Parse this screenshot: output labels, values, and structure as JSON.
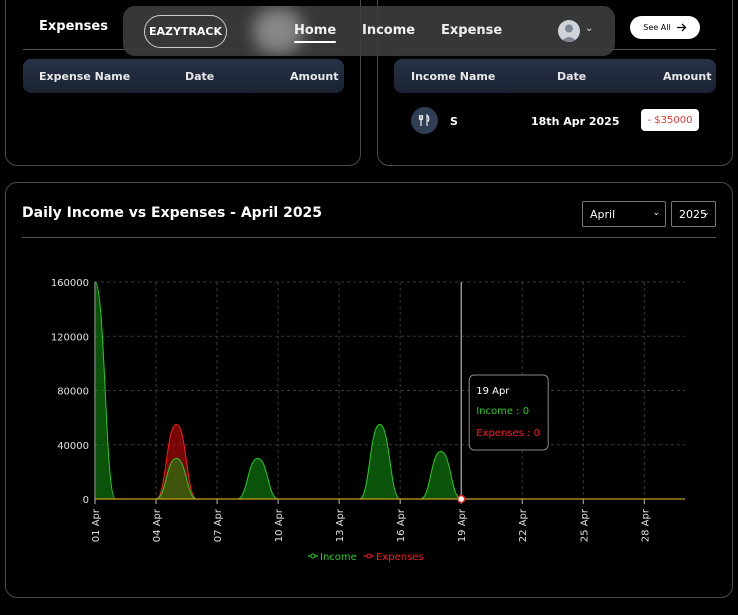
{
  "expenses_panel": {
    "title": "Expenses",
    "columns": [
      "Expense Name",
      "Date",
      "Amount"
    ]
  },
  "income_panel": {
    "see_all": "See All",
    "columns": [
      "Income Name",
      "Date",
      "Amount"
    ],
    "rows": [
      {
        "icon": "fork-knife-icon",
        "name": "S",
        "date": "18th Apr 2025",
        "amount": "- $35000"
      }
    ]
  },
  "navbar": {
    "brand": "EAZYTRACK",
    "links": [
      "Home",
      "Income",
      "Expense"
    ],
    "active": "Home"
  },
  "chart_panel": {
    "title": "Daily Income vs Expenses - April 2025",
    "month_select": "April",
    "year_select": "2025",
    "tooltip": {
      "date": "19 Apr",
      "income": "Income : 0",
      "expenses": "Expenses : 0"
    }
  },
  "colors": {
    "income": "#1fd11f",
    "expenses": "#ff1a1a",
    "background": "#000000",
    "panel_border": "#4a4a4a"
  },
  "chart_data": {
    "type": "area",
    "x": [
      "01 Apr",
      "02 Apr",
      "03 Apr",
      "04 Apr",
      "05 Apr",
      "06 Apr",
      "07 Apr",
      "08 Apr",
      "09 Apr",
      "10 Apr",
      "11 Apr",
      "12 Apr",
      "13 Apr",
      "14 Apr",
      "15 Apr",
      "16 Apr",
      "17 Apr",
      "18 Apr",
      "19 Apr",
      "20 Apr",
      "21 Apr",
      "22 Apr",
      "23 Apr",
      "24 Apr",
      "25 Apr",
      "26 Apr",
      "27 Apr",
      "28 Apr",
      "29 Apr",
      "30 Apr"
    ],
    "x_tick_labels": [
      "01 Apr",
      "04 Apr",
      "07 Apr",
      "10 Apr",
      "13 Apr",
      "16 Apr",
      "19 Apr",
      "22 Apr",
      "25 Apr",
      "28 Apr"
    ],
    "series": [
      {
        "name": "Income",
        "values": [
          160000,
          0,
          0,
          0,
          30000,
          0,
          0,
          0,
          30000,
          0,
          0,
          0,
          0,
          0,
          55000,
          0,
          0,
          35000,
          0,
          0,
          0,
          0,
          0,
          0,
          0,
          0,
          0,
          0,
          0,
          0
        ]
      },
      {
        "name": "Expenses",
        "values": [
          0,
          0,
          0,
          0,
          55000,
          0,
          0,
          0,
          0,
          0,
          0,
          0,
          0,
          0,
          0,
          0,
          0,
          0,
          0,
          0,
          0,
          0,
          0,
          0,
          0,
          0,
          0,
          0,
          0,
          0
        ]
      }
    ],
    "ylim": [
      0,
      160000
    ],
    "y_ticks": [
      0,
      40000,
      80000,
      120000,
      160000
    ],
    "grid": true,
    "legend": "bottom",
    "highlight": "19 Apr"
  }
}
